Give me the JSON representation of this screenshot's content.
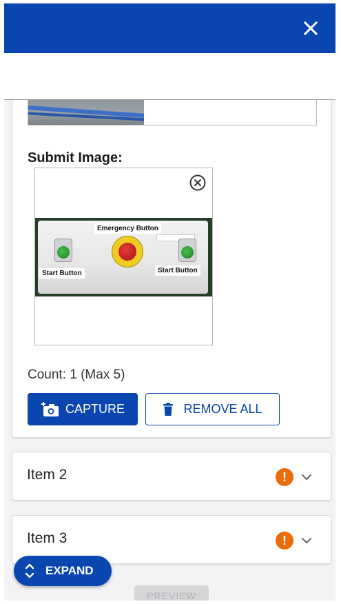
{
  "header": {
    "close_icon": "close-icon",
    "color": "#0a46b0"
  },
  "submit": {
    "label": "Submit Image:",
    "photo_tags": {
      "emergency": "Emergency Button",
      "start_left": "Start Button",
      "start_right": "Start Button"
    },
    "count_text": "Count: 1 (Max 5)",
    "capture_label": "CAPTURE",
    "remove_all_label": "REMOVE ALL"
  },
  "items": [
    {
      "label": "Item 2",
      "status_icon": "warning-icon",
      "status_color": "#ea6c0a"
    },
    {
      "label": "Item 3",
      "status_icon": "warning-icon",
      "status_color": "#ea6c0a"
    }
  ],
  "footer": {
    "preview_label": "PREVIEW",
    "expand_label": "EXPAND"
  }
}
